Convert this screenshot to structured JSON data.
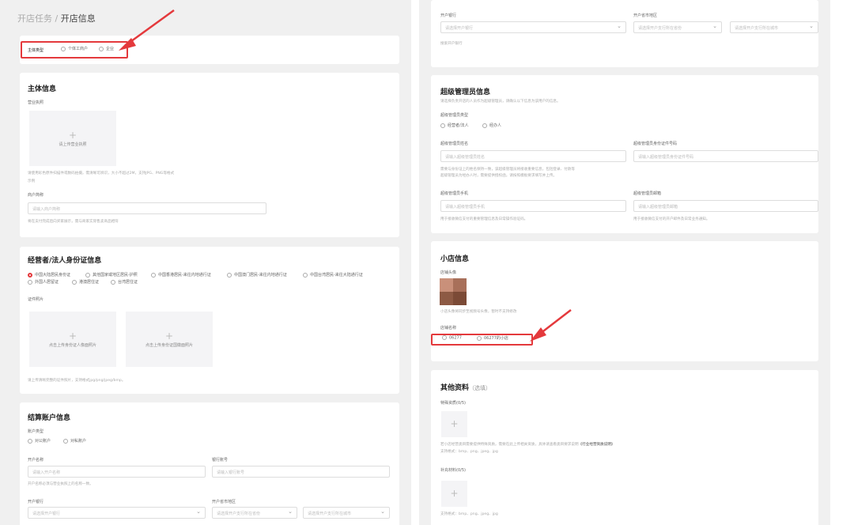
{
  "breadcrumb": {
    "parent": "开店任务",
    "sep": " / ",
    "current": "开店信息"
  },
  "left": {
    "entity_type": {
      "label": "主体类型",
      "options": [
        "个体工商户",
        "企业"
      ]
    },
    "entity_info": {
      "title": "主体信息",
      "license_label": "营业执照",
      "license_upload": "请上传营业执照",
      "license_hint_1": "请使用彩色原件扫描件或数码拍摄，需清晰可辨识，大小不超过2M，支持JPG、PNG等格式",
      "license_hint_2": "示例",
      "merchant_label": "商户简称",
      "merchant_placeholder": "请输入商户简称",
      "merchant_hint": "将在支付完成后向买家展示，需与商家实际售卖商品相符"
    },
    "id_info": {
      "title": "经营者/法人身份证信息",
      "options_row1": [
        "中国大陆居民身份证",
        "其他国家或地区居民-护照",
        "中国香港居民-来往内地通行证",
        "中国澳门居民-来往内地通行证",
        "中国台湾居民-来往大陆通行证"
      ],
      "options_row2": [
        "外国人居留证",
        "港澳居住证",
        "台湾居住证"
      ],
      "photo_label": "证件照片",
      "upload_front": "点击上传身份证人像面照片",
      "upload_back": "点击上传身份证国徽面照片",
      "photo_hint": "请上传清晰完整的证件照片，支持格式jpg/png/jpeg/bmp。"
    },
    "settlement": {
      "title": "结算账户信息",
      "acct_type_label": "账户类型",
      "acct_types": [
        "对公账户",
        "对私账户"
      ],
      "acct_name_label": "开户名称",
      "acct_name_placeholder": "请输入开户名称",
      "acct_name_hint": "开户名称必须与营业执照上的名称一致。",
      "acct_no_label": "银行账号",
      "acct_no_placeholder": "请输入银行账号",
      "bank_label": "开户银行",
      "bank_placeholder": "请选择开户银行",
      "region_label": "开户省市地区",
      "province_placeholder": "请选择开户支行所在省份",
      "city_placeholder": "请选择开户支行所在城市"
    }
  },
  "right": {
    "bank": {
      "bank_label": "开户银行",
      "bank_placeholder": "请选择开户银行",
      "region_label": "开户省市地区",
      "province_placeholder": "请选择开户支行所在省份",
      "city_placeholder": "请选择开户支行所在城市",
      "hint": "搜索开户银行"
    },
    "admin": {
      "title": "超级管理员信息",
      "desc": "请选择负责开店的人员作为超级管理员，请确认以下信息为该用户的信息。",
      "type_label": "超级管理员类型",
      "types": [
        "经营者/法人",
        "经办人"
      ],
      "name_label": "超级管理员姓名",
      "name_placeholder": "请输入超级管理员姓名",
      "name_hint_1": "需要与身份证上的姓名保持一致，该超级管理员将接收重要信息，包括登录、付款等",
      "name_hint_2": "超级管理员为经办人时，需要提供授权函，请按照模板要求填写并上传。",
      "id_label": "超级管理员身份证件号码",
      "id_placeholder": "请输入超级管理员身份证件号码",
      "phone_label": "超级管理员手机",
      "phone_placeholder": "请输入超级管理员手机",
      "phone_hint": "用于接收微信支付的重要管理信息及日常操作验证码。",
      "email_label": "超级管理员邮箱",
      "email_placeholder": "请输入超级管理员邮箱",
      "email_hint": "用于接收微信支付的开户邮件及日常业务通知。"
    },
    "shop": {
      "title": "小店信息",
      "avatar_label": "店铺头像",
      "avatar_hint": "小店头像将同步至视频号头像，暂时不支持修改",
      "name_label": "店铺名称",
      "name_options": [
        "06277",
        "06277的小店"
      ]
    },
    "other": {
      "title": "其他资料",
      "title_suffix": "（选填）",
      "special_label": "特殊资质(0/5)",
      "special_hint": "若小店经营类目需要提供特殊资质，需要在此上传相关资质，具体请查看类目要求说明",
      "special_link": "《行业经营资质说明》",
      "special_formats": "支持格式：bmp、png、jpeg、jpg",
      "extra_label": "补充材料(0/5)",
      "extra_formats": "支持格式：bmp、png、jpeg、jpg"
    }
  },
  "colors": {
    "accent": "#e4393c",
    "page_bg": "#f0f0f0",
    "card_bg": "#ffffff"
  },
  "icons": {
    "upload": "plus-icon",
    "select": "chevron-down-icon"
  }
}
